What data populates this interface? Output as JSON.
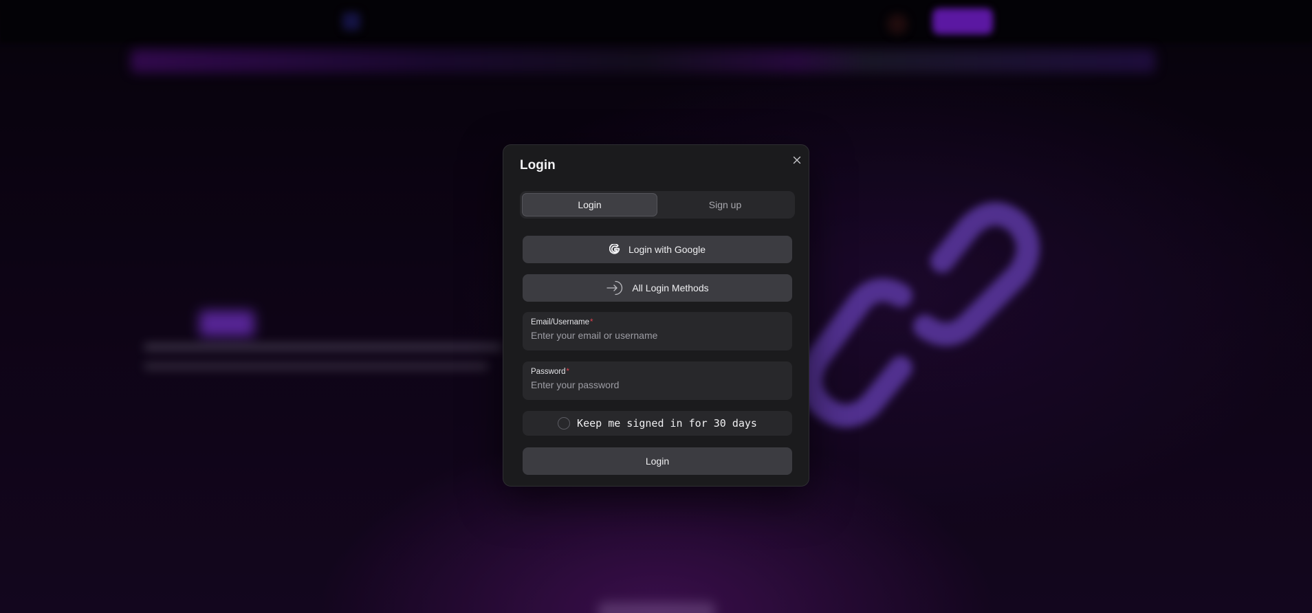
{
  "modal": {
    "title": "Login",
    "close_icon": "close-icon"
  },
  "tabs": [
    {
      "label": "Login",
      "active": true
    },
    {
      "label": "Sign up",
      "active": false
    }
  ],
  "buttons": {
    "google": {
      "label": "Login with Google",
      "icon": "google-icon"
    },
    "all_methods": {
      "label": "All Login Methods",
      "icon": "login-arrow-icon"
    },
    "submit": {
      "label": "Login"
    }
  },
  "fields": {
    "email": {
      "label": "Email/Username",
      "required_mark": "*",
      "placeholder": "Enter your email or username",
      "value": ""
    },
    "password": {
      "label": "Password",
      "required_mark": "*",
      "placeholder": "Enter your password",
      "value": ""
    }
  },
  "remember": {
    "label": "Keep me signed in for 30 days",
    "checked": false
  },
  "colors": {
    "modal_bg": "#1b1b1d",
    "button_bg": "#3c3c41",
    "field_bg": "#28282b",
    "required": "#e0414f",
    "background_accent": "#7a20d8"
  }
}
